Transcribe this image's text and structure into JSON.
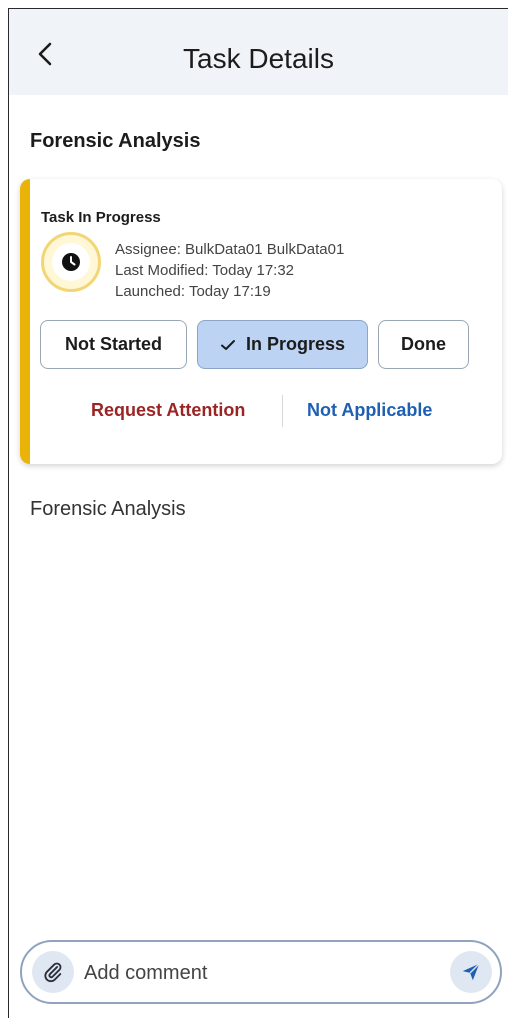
{
  "header": {
    "title": "Task Details",
    "back_icon": "chevron-left-icon"
  },
  "task": {
    "section_title": "Forensic Analysis",
    "status_title": "Task In Progress",
    "status_icon": "clock-icon",
    "accent_color": "#eab308",
    "assignee": "Assignee: BulkData01 BulkData01",
    "last_modified": "Last Modified: Today 17:32",
    "launched": "Launched: Today 17:19",
    "status_buttons": [
      {
        "label": "Not Started",
        "selected": false
      },
      {
        "label": "In Progress",
        "selected": true
      },
      {
        "label": "Done",
        "selected": false
      }
    ],
    "request_attention": "Request Attention",
    "not_applicable": "Not Applicable"
  },
  "description": "Forensic Analysis",
  "comment": {
    "placeholder": "Add comment",
    "attach_icon": "paperclip-icon",
    "send_icon": "send-icon"
  }
}
